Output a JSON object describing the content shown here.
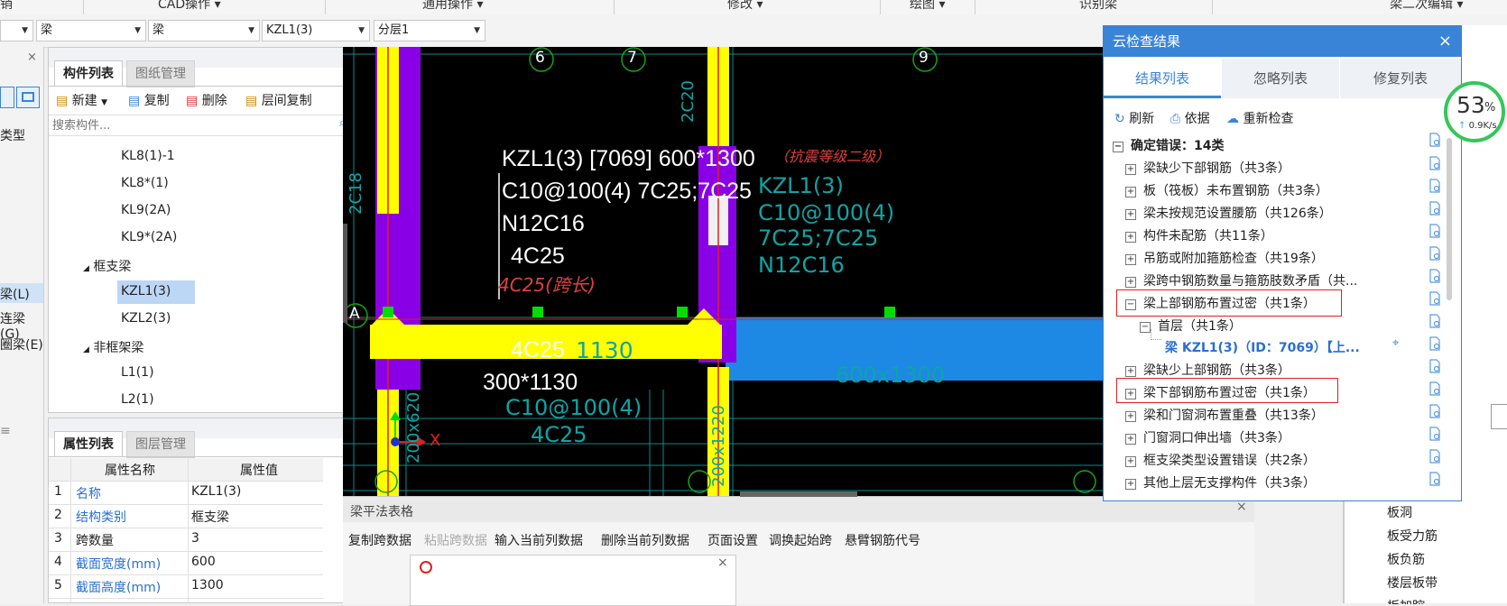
{
  "menubar": {
    "items": [
      "销",
      "CAD操作 ▾",
      "通用操作 ▾",
      "修改 ▾",
      "绘图 ▾",
      "识别梁",
      "梁二次编辑 ▾"
    ]
  },
  "filters": {
    "combo0": "",
    "combo1": "梁",
    "combo2": "梁",
    "combo3": "KZL1(3)",
    "combo4": "分层1"
  },
  "left_strip": {
    "label_type": "类型",
    "items": [
      "梁(L)",
      "连梁(G)",
      "圈梁(E)"
    ]
  },
  "component_panel": {
    "tab_active": "构件列表",
    "tab_inactive": "图纸管理",
    "toolbar": {
      "new": "新建",
      "copy": "复制",
      "delete": "删除",
      "floor_copy": "层间复制"
    },
    "search_placeholder": "搜索构件...",
    "tree": {
      "items": [
        "KL8(1)-1",
        "KL8*(1)",
        "KL9(2A)",
        "KL9*(2A)"
      ],
      "group1": "框支梁",
      "group1_items": [
        "KZL1(3)",
        "KZL2(3)"
      ],
      "group2": "非框架梁",
      "group2_items": [
        "L1(1)",
        "L2(1)"
      ]
    }
  },
  "property_panel": {
    "tab_active": "属性列表",
    "tab_inactive": "图层管理",
    "col_name": "属性名称",
    "col_value": "属性值",
    "rows": [
      {
        "n": "1",
        "name": "名称",
        "value": "KZL1(3)"
      },
      {
        "n": "2",
        "name": "结构类别",
        "value": "框支梁"
      },
      {
        "n": "3",
        "name": "跨数量",
        "value": "3"
      },
      {
        "n": "4",
        "name": "截面宽度(mm)",
        "value": "600"
      },
      {
        "n": "5",
        "name": "截面高度(mm)",
        "value": "1300"
      }
    ]
  },
  "canvas": {
    "axis_6": "6",
    "axis_7": "7",
    "axis_9": "9",
    "axis_a": "A",
    "beam_title": "KZL1(3) [7069] 600*1300",
    "seismic_note": "（抗震等级二级）",
    "stirrup": "C10@100(4) 7C25;7C25",
    "side_bars": "N12C16",
    "top_bars": "4C25",
    "top_bars_red": "4C25(跨长)",
    "bottom_bars": "4C25",
    "span_size": "300*1130",
    "cad_1130": "1130",
    "cad_kzl": "KZL1(3)",
    "cad_c10": "C10@100(4)",
    "cad_7c25": "7C25;7C25",
    "cad_n12": "N12C16",
    "cad_600": "600x1300",
    "cad_2c20": "2C20",
    "cad_2c18": "2C18",
    "cad_c10_b": "C10@100(4)",
    "cad_4c25_b": "4C25",
    "cad_col": "200x620",
    "cad_col2": "200x1220",
    "axis_x": "X"
  },
  "bottom": {
    "title": "梁平法表格",
    "toolbar": [
      "复制跨数据",
      "粘贴跨数据",
      "输入当前列数据",
      "删除当前列数据",
      "页面设置",
      "调换起始跨",
      "悬臂钢筋代号"
    ]
  },
  "cloud": {
    "title": "云检查结果",
    "tabs": [
      "结果列表",
      "忽略列表",
      "修复列表"
    ],
    "actions": {
      "refresh": "刷新",
      "basis": "依据",
      "recheck": "重新检查"
    },
    "group": "确定错误：14类",
    "rows": [
      "梁缺少下部钢筋（共3条）",
      "板（筏板）未布置钢筋（共3条）",
      "梁未按规范设置腰筋（共126条）",
      "构件未配筋（共11条）",
      "吊筋或附加箍筋检查（共19条）",
      "梁跨中钢筋数量与箍筋肢数矛盾（共..."
    ],
    "top_dense": "梁上部钢筋布置过密（共1条）",
    "floor": "首层（共1条）",
    "beam_item": "梁 KZL1(3)（ID：7069）【上...",
    "rows2_a": "梁缺少上部钢筋（共3条）",
    "bottom_dense": "梁下部钢筋布置过密（共1条）",
    "rows3": [
      "梁和门窗洞布置重叠（共13条）",
      "门窗洞口伸出墙（共3条）",
      "框支梁类型设置错误（共2条）",
      "其他上层无支撑构件（共3条）"
    ]
  },
  "net": {
    "percent": "53",
    "unit": "%",
    "speed": "0.9K/s"
  },
  "far_right": {
    "items": [
      "板洞",
      "板受力筋",
      "板负筋",
      "楼层板带",
      "板加腔"
    ]
  },
  "colors": {
    "accent": "#3a84d8",
    "beam_yellow": "#ffff00",
    "beam_blue": "#1e88e5",
    "column_purple": "#8a00e6",
    "cad_cyan": "#18a0a0",
    "error_red": "#e02020"
  }
}
